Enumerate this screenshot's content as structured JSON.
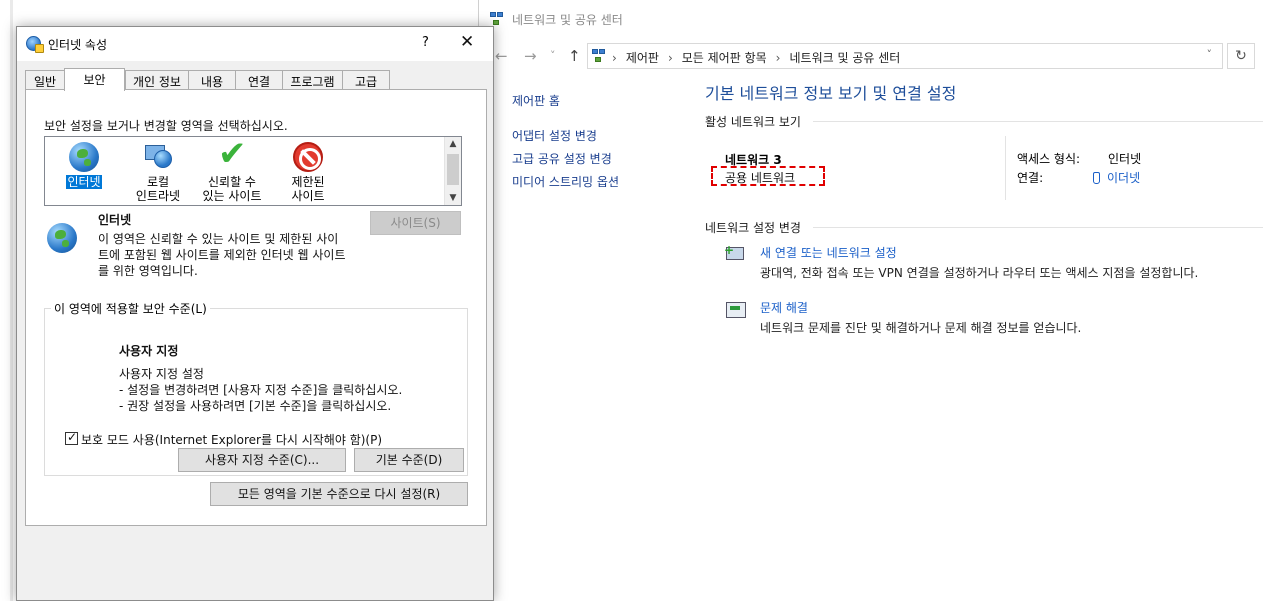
{
  "network_window": {
    "title": "네트워크 및 공유 센터",
    "nav": {
      "back": "←",
      "forward": "→",
      "recent": "˅",
      "up": "↑",
      "dropdown": "˅",
      "refresh": "↻"
    },
    "breadcrumb": [
      "제어판",
      "모든 제어판 항목",
      "네트워크 및 공유 센터"
    ],
    "breadcrumb_sep": "›",
    "left_nav": [
      "제어판 홈",
      "어댑터 설정 변경",
      "고급 공유 설정 변경",
      "미디어 스트리밍 옵션"
    ],
    "heading": "기본 네트워크 정보 보기 및 연결 설정",
    "active_section": "활성 네트워크 보기",
    "network_name": "네트워크 3",
    "network_category": "공용 네트워크",
    "access_type_label": "액세스 형식:",
    "access_type_value": "인터넷",
    "connection_label": "연결:",
    "connection_value": "이더넷",
    "change_section": "네트워크 설정 변경",
    "tasks": [
      {
        "title": "새 연결 또는 네트워크 설정",
        "desc": "광대역, 전화 접속 또는 VPN 연결을 설정하거나 라우터 또는 액세스 지점을 설정합니다.",
        "icon": "new-connection-icon"
      },
      {
        "title": "문제 해결",
        "desc": "네트워크 문제를 진단 및 해결하거나 문제 해결 정보를 얻습니다.",
        "icon": "troubleshoot-icon"
      }
    ]
  },
  "dialog": {
    "title": "인터넷 속성",
    "help": "?",
    "close": "✕",
    "tabs": [
      "일반",
      "보안",
      "개인 정보",
      "내용",
      "연결",
      "프로그램",
      "고급"
    ],
    "active_tab": "보안",
    "instruction": "보안 설정을 보거나 변경할 영역을 선택하십시오.",
    "zones": [
      {
        "label": "인터넷",
        "icon": "internet-globe-icon",
        "selected": true
      },
      {
        "label": "로컬\n인트라넷",
        "icon": "local-intranet-icon",
        "selected": false
      },
      {
        "label": "신뢰할 수\n있는 사이트",
        "icon": "trusted-sites-check-icon",
        "selected": false
      },
      {
        "label": "제한된\n사이트",
        "icon": "restricted-sites-icon",
        "selected": false
      }
    ],
    "zone_title": "인터넷",
    "zone_desc_lines": [
      "이 영역은 신뢰할 수 있는 사이트 및 제한된 사이",
      "트에 포함된 웹 사이트를 제외한 인터넷 웹 사이트",
      "를 위한 영역입니다."
    ],
    "sites_button": "사이트(S)",
    "level_group_label": "이 영역에 적용할 보안 수준(L)",
    "level_title": "사용자 지정",
    "level_lines": [
      "사용자 지정 설정",
      "- 설정을 변경하려면 [사용자 지정 수준]을 클릭하십시오.",
      "- 권장 설정을 사용하려면 [기본 수준]을 클릭하십시오."
    ],
    "protected_mode": "보호 모드 사용(Internet Explorer를 다시 시작해야 함)(P)",
    "protected_mode_checked": true,
    "custom_level_button": "사용자 지정 수준(C)...",
    "default_level_button": "기본 수준(D)",
    "reset_all_button": "모든 영역을 기본 수준으로 다시 설정(R)"
  },
  "colors": {
    "link": "#1a5fc8",
    "heading": "#1e4e9a",
    "selection": "#0078d7",
    "annotation": "#e00000"
  }
}
